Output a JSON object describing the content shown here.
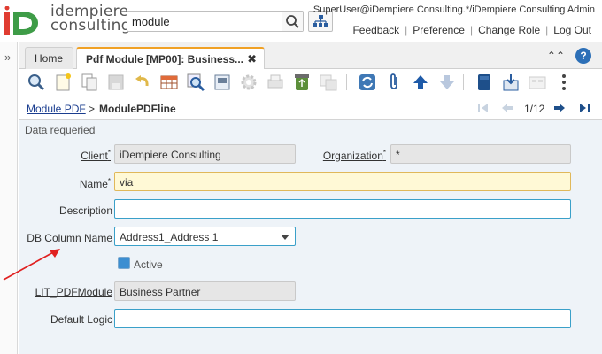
{
  "header": {
    "logo_line1": "idempiere",
    "logo_line2": "consulting",
    "search_value": "module",
    "user": "SuperUser@iDempiere Consulting.*/iDempiere Consulting Admin",
    "links": [
      "Feedback",
      "Preference",
      "Change Role",
      "Log Out"
    ]
  },
  "tabs": [
    {
      "label": "Home",
      "active": false
    },
    {
      "label": "Pdf Module [MP00]: Business...",
      "active": true
    }
  ],
  "breadcrumb": {
    "link": "Module PDF",
    "separator": ">",
    "current": "ModulePDFline",
    "page_indicator": "1/12"
  },
  "form": {
    "section_label": "Data requeried",
    "fields": {
      "client": {
        "label": "Client",
        "value": "iDempiere Consulting"
      },
      "organization": {
        "label": "Organization",
        "value": "*"
      },
      "name": {
        "label": "Name",
        "value": "via"
      },
      "description": {
        "label": "Description",
        "value": ""
      },
      "db_column_name": {
        "label": "DB Column Name",
        "value": "Address1_Address 1"
      },
      "active": {
        "label": "Active",
        "checked": true
      },
      "lit_pdfmodule": {
        "label": "LIT_PDFModule",
        "value": "Business Partner"
      },
      "default_logic": {
        "label": "Default Logic",
        "value": ""
      }
    }
  },
  "toolbar_icons": [
    "search-icon",
    "new-record-icon",
    "copy-icon",
    "save-icon",
    "undo-icon",
    "grid-toggle-icon",
    "zoom-icon",
    "report-icon",
    "settings-icon",
    "print-icon",
    "recycle-icon",
    "archive-icon",
    "refresh-icon",
    "attachment-icon",
    "arrow-up-icon",
    "arrow-down-icon",
    "product-info-icon",
    "export-icon",
    "quick-form-icon",
    "more-icon"
  ],
  "colors": {
    "tab_accent": "#f0a125",
    "link": "#1a3d8f",
    "required_bg": "#fff9d6",
    "form_bg": "#eef3f8",
    "checkbox": "#3c8ed1",
    "annotation_arrow": "#e02020"
  }
}
